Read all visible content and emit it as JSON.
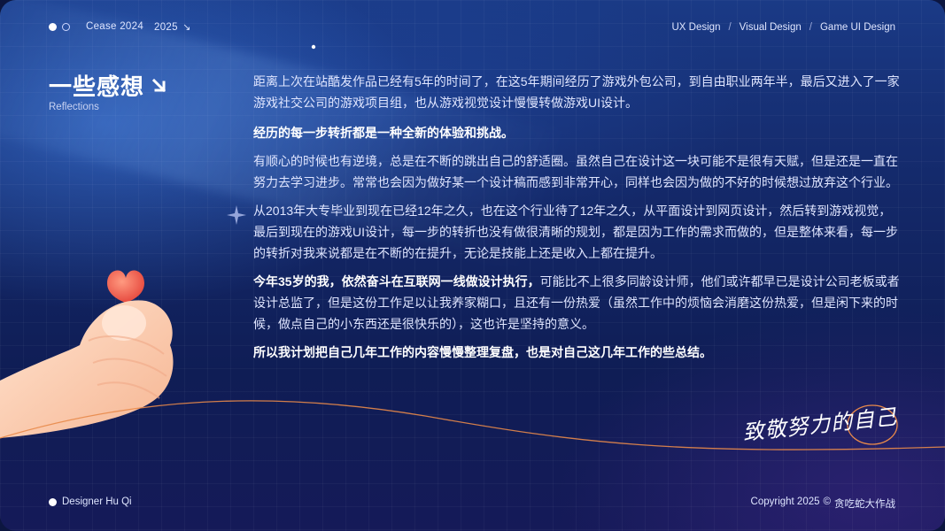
{
  "header": {
    "years_from": "Cease 2024",
    "years_to": "2025",
    "nav": [
      "UX Design",
      "/",
      "Visual Design",
      "/",
      "Game UI Design"
    ]
  },
  "section": {
    "title": "一些感想",
    "subtitle": "Reflections"
  },
  "content": {
    "p1": "距离上次在站酷发作品已经有5年的时间了，在这5年期间经历了游戏外包公司，到自由职业两年半，最后又进入了一家游戏社交公司的游戏项目组，也从游戏视觉设计慢慢转做游戏UI设计。",
    "p2": "经历的每一步转折都是一种全新的体验和挑战。",
    "p3": "有顺心的时候也有逆境，总是在不断的跳出自己的舒适圈。虽然自己在设计这一块可能不是很有天赋，但是还是一直在努力去学习进步。常常也会因为做好某一个设计稿而感到非常开心，同样也会因为做的不好的时候想过放弃这个行业。",
    "p4": "从2013年大专毕业到现在已经12年之久，也在这个行业待了12年之久，从平面设计到网页设计，然后转到游戏视觉，最后到现在的游戏UI设计，每一步的转折也没有做很清晰的规划，都是因为工作的需求而做的，但是整体来看，每一步的转折对我来说都是在不断的在提升，无论是技能上还是收入上都在提升。",
    "p5_bold": "今年35岁的我，依然奋斗在互联网一线做设计执行，",
    "p5_rest": "可能比不上很多同龄设计师，他们或许都早已是设计公司老板或者设计总监了，但是这份工作足以让我养家糊口，且还有一份热爱（虽然工作中的烦恼会消磨这份热爱，但是闲下来的时候，做点自己的小东西还是很快乐的），这也许是坚持的意义。",
    "p6": "所以我计划把自己几年工作的内容慢慢整理复盘，也是对自己这几年工作的些总结。"
  },
  "signature": "致敬努力的自己",
  "footer": {
    "designer": "Designer Hu Qi",
    "copyright": "Copyright 2025",
    "copyright_symbol": "©",
    "author": "贪吃蛇大作战"
  },
  "colors": {
    "accent_orange": "#e8894a",
    "bg_dark": "#0f1d55",
    "text_light": "#dfe5ff"
  }
}
